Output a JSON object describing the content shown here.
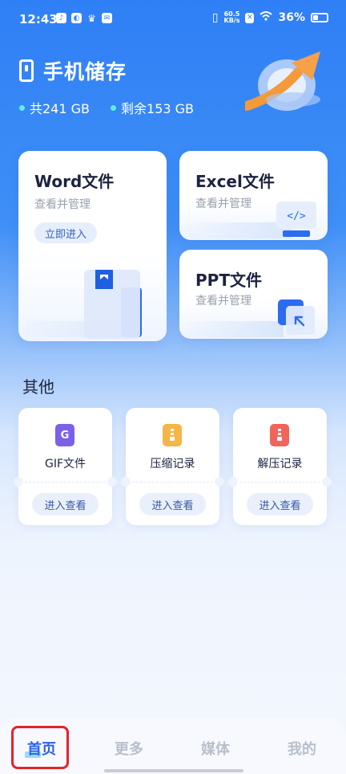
{
  "status_bar": {
    "time": "12:43",
    "net_speed_value": "60.5",
    "net_speed_unit": "KB/s",
    "battery": "36%"
  },
  "header": {
    "title": "手机储存",
    "total": "共241 GB",
    "free": "剩余153 GB"
  },
  "cards": {
    "word": {
      "title": "Word文件",
      "subtitle": "查看并管理",
      "button": "立即进入"
    },
    "excel": {
      "title": "Excel文件",
      "subtitle": "查看并管理"
    },
    "ppt": {
      "title": "PPT文件",
      "subtitle": "查看并管理"
    }
  },
  "other": {
    "title": "其他",
    "items": [
      {
        "icon_text": "G",
        "label": "GIF文件",
        "button": "进入查看",
        "color": "#7b61e8"
      },
      {
        "icon_text": "",
        "label": "压缩记录",
        "button": "进入查看",
        "color": "#f5b547"
      },
      {
        "icon_text": "",
        "label": "解压记录",
        "button": "进入查看",
        "color": "#f0645c"
      }
    ]
  },
  "nav": {
    "home": "首页",
    "more": "更多",
    "media": "媒体",
    "mine": "我的"
  },
  "colors": {
    "accent": "#2a62e8",
    "highlight": "#e0252a"
  }
}
